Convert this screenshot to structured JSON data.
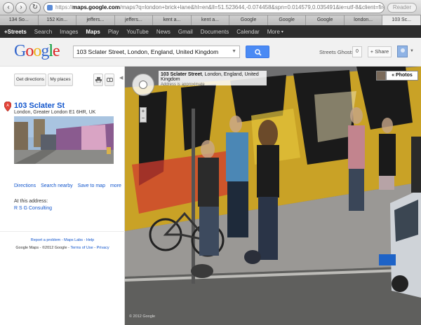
{
  "browser": {
    "url_scheme": "https://",
    "url_host": "maps.google.com",
    "url_rest": "/maps?q=london+brick+lane&hl=en&ll=51.523644,-0.074458&spn=0.014579,0.035491&ie=utf-8&client=firefox-a&channel=np&hq=brick",
    "reader_label": "Reader",
    "tabs": [
      "134 So...",
      "152 Kin...",
      "jeffers...",
      "jeffers...",
      "kent a...",
      "kent a...",
      "Google",
      "Google",
      "Google",
      "london...",
      "103 Sc..."
    ]
  },
  "gbar": {
    "items": [
      "+Streets",
      "Search",
      "Images",
      "Maps",
      "Play",
      "YouTube",
      "News",
      "Gmail",
      "Documents",
      "Calendar",
      "More"
    ],
    "active": "Maps"
  },
  "header": {
    "logo_letters": [
      {
        "ch": "G",
        "color": "#3366cc"
      },
      {
        "ch": "o",
        "color": "#dd2222"
      },
      {
        "ch": "o",
        "color": "#eeb211"
      },
      {
        "ch": "g",
        "color": "#3366cc"
      },
      {
        "ch": "l",
        "color": "#009933"
      },
      {
        "ch": "e",
        "color": "#dd2222"
      }
    ],
    "search_value": "103 Sclater Street, London, England, United Kingdom",
    "streets_ghosts": "Streets Ghosts",
    "count": "0",
    "share_label": "+ Share"
  },
  "left_panel": {
    "get_directions": "Get directions",
    "my_places": "My places",
    "place_title": "103 Sclater St",
    "place_address": "London, Greater London E1 6HR, UK",
    "links": [
      "Directions",
      "Search nearby",
      "Save to map",
      "more"
    ],
    "at_this_address": "At this address:",
    "business": "R S G Consulting",
    "footer_line1": "Report a problem - Maps Labs - Help",
    "footer_prefix": "Google Maps - ©2012 Google - ",
    "footer_terms": "Terms of Use",
    "footer_sep": " - ",
    "footer_privacy": "Privacy"
  },
  "streetview": {
    "label_street": "103 Sclater Street",
    "label_rest": ", London, England, United Kingdom",
    "label_note": "Address is approximate",
    "photos_label": "« Photos",
    "copyright": "© 2012 Google"
  },
  "colors": {
    "link": "#1155cc",
    "search_button": "#4a8af4",
    "gbar_bg": "#2d2d2d"
  }
}
